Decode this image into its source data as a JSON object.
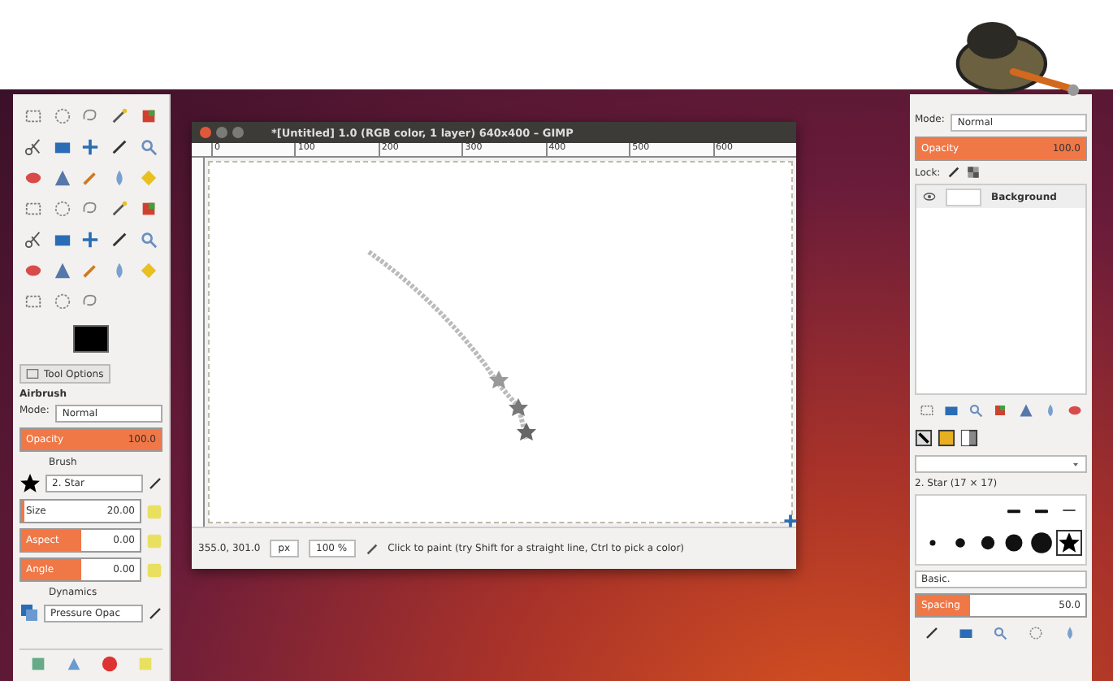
{
  "toolbox": {
    "tool_options_tab": "Tool Options",
    "tool_name": "Airbrush",
    "mode": {
      "label": "Mode:",
      "value": "Normal"
    },
    "opacity": {
      "label": "Opacity",
      "reading": "100.0",
      "level": 1
    },
    "brush": {
      "label": "Brush",
      "value": "2. Star"
    },
    "sliders": [
      {
        "label": "Size",
        "reading": "20.00",
        "level": 0.03
      },
      {
        "label": "Aspect",
        "reading": "0.00",
        "level": 0.5
      },
      {
        "label": "Angle",
        "reading": "0.00",
        "level": 0.5
      }
    ],
    "dynamics": {
      "label": "Dynamics",
      "value": "Pressure Opac"
    }
  },
  "image_window": {
    "title": "*[Untitled] 1.0 (RGB color, 1 layer) 640x400 – GIMP",
    "ruler_labels": [
      "0",
      "100",
      "200",
      "300",
      "400",
      "500",
      "600"
    ],
    "status": {
      "coordinates": "355.0, 301.0",
      "unit": "px",
      "zoom": "100 %",
      "message": "Click to paint (try Shift for a straight line, Ctrl to pick a color)"
    }
  },
  "layers_dock": {
    "mode": {
      "label": "Mode:",
      "value": "Normal"
    },
    "opacity": {
      "label": "Opacity",
      "reading": "100.0",
      "level": 1
    },
    "lock_label": "Lock:",
    "layers": [
      {
        "name": "Background",
        "visible": true
      }
    ]
  },
  "brushes_dock": {
    "brush_title": "2. Star (17 × 17)",
    "brushes": [
      {
        "kind": "line",
        "selected": false
      },
      {
        "kind": "line",
        "selected": false
      },
      {
        "kind": "line",
        "selected": false
      },
      {
        "kind": "dot",
        "selected": false
      },
      {
        "kind": "dot",
        "selected": false
      },
      {
        "kind": "dot",
        "selected": false
      },
      {
        "kind": "dot",
        "selected": false
      },
      {
        "kind": "dot",
        "selected": false
      },
      {
        "kind": "star",
        "selected": true
      }
    ],
    "preset": "Basic.",
    "spacing": {
      "label": "Spacing",
      "reading": "50.0",
      "level": 0.32
    }
  }
}
